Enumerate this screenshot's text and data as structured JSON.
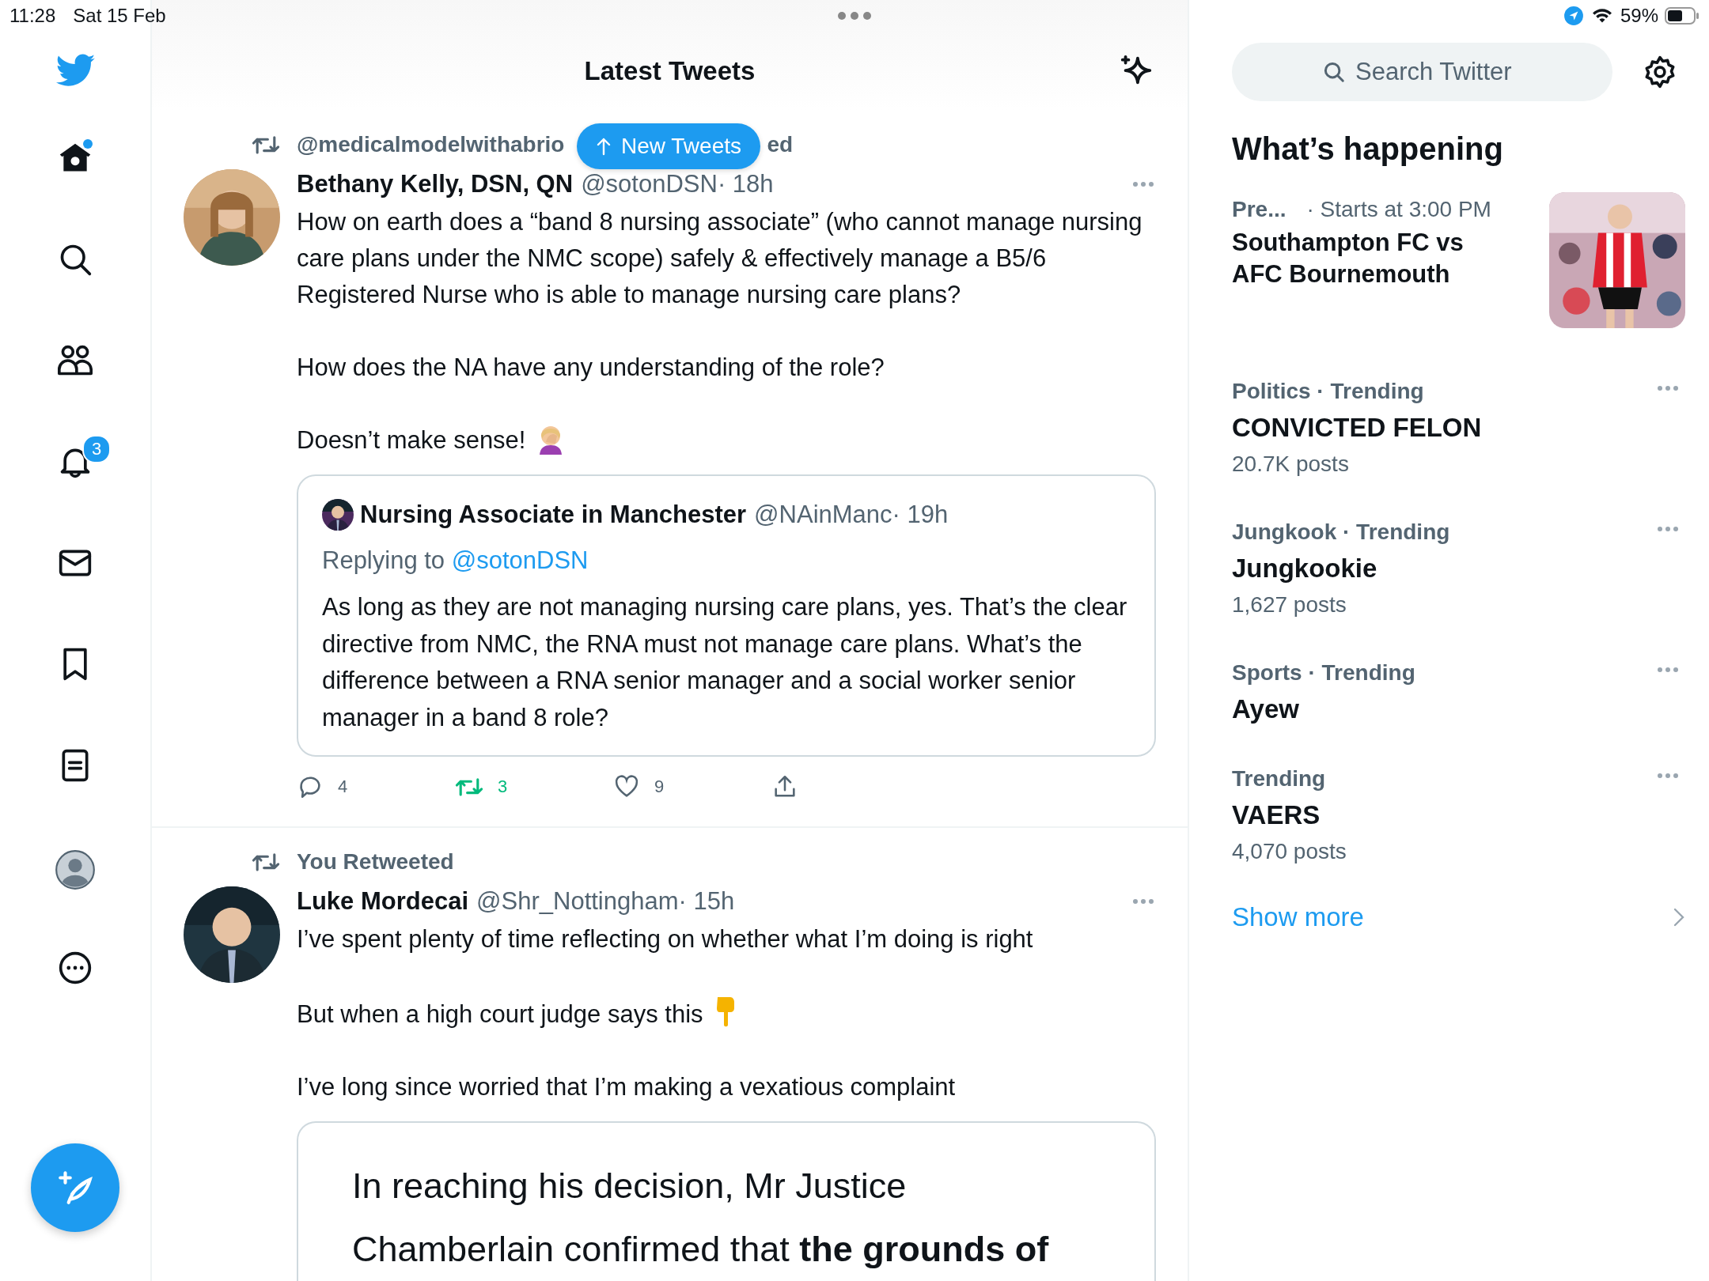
{
  "status_bar": {
    "time": "11:28",
    "date": "Sat 15 Feb",
    "battery": "59%"
  },
  "nav": {
    "home_unread": true,
    "notifications_badge": "3"
  },
  "header": {
    "title": "Latest Tweets"
  },
  "new_tweets": {
    "label": "New Tweets"
  },
  "tweets": [
    {
      "context": [
        "@medicalmodelwithabrio",
        "ed"
      ],
      "name": "Bethany Kelly, DSN, QN",
      "handle": "@sotonDSN",
      "time": "· 18h",
      "paragraphs": [
        {
          "text": "How on earth does a “band 8 nursing associate” (who cannot manage nursing care plans under the NMC scope) safely & effectively manage a B5/6 Registered Nurse who is able to manage nursing care plans?"
        },
        {
          "text": "How does the NA have any understanding of the role?"
        },
        {
          "text": "Doesn’t make sense!",
          "kind": "with_facepalm"
        }
      ],
      "quote": {
        "kind": "tweet",
        "name": "Nursing Associate in Manchester",
        "handle": "@NAinManc",
        "time": "· 19h",
        "replying_prefix": "Replying to",
        "replying_to": "@sotonDSN",
        "text": "As long as they are not managing nursing care plans, yes. That’s the clear directive from NMC, the RNA must not manage care plans. What’s the difference between a RNA senior manager and a social worker senior manager in a band 8 role?"
      },
      "actions": {
        "replies": "4",
        "retweets": "3",
        "likes": "9",
        "retweeted": true,
        "liked": false
      }
    },
    {
      "context": [
        "You Retweeted"
      ],
      "name": "Luke Mordecai",
      "handle": "@Shr_Nottingham",
      "time": "· 15h",
      "paragraphs": [
        {
          "text": "I’ve spent plenty of time reflecting on whether what I’m doing is right"
        },
        {
          "text": "But when a high court judge says this",
          "kind": "with_point_down"
        },
        {
          "text": "I’ve long since worried that I’m making a vexatious complaint"
        }
      ],
      "quote": {
        "kind": "document",
        "lines": [
          "In reaching his decision, Mr Justice",
          "Chamberlain confirmed that **the grounds of**"
        ]
      }
    }
  ],
  "search": {
    "placeholder": "Search Twitter"
  },
  "trends_title": "What’s happening",
  "trends": [
    {
      "kind": "event",
      "category": "Pre...",
      "meta": "· Starts at 3:00 PM",
      "name": "Southampton FC vs AFC Bournemouth"
    },
    {
      "kind": "trend",
      "category": "Politics · Trending",
      "name": "CONVICTED FELON",
      "posts": "20.7K posts"
    },
    {
      "kind": "trend",
      "category": "Jungkook · Trending",
      "name": "Jungkookie",
      "posts": "1,627 posts"
    },
    {
      "kind": "trend",
      "category": "Sports · Trending",
      "name": "Ayew"
    },
    {
      "kind": "trend",
      "category": "Trending",
      "name": "VAERS",
      "posts": "4,070 posts"
    }
  ],
  "show_more": "Show more"
}
